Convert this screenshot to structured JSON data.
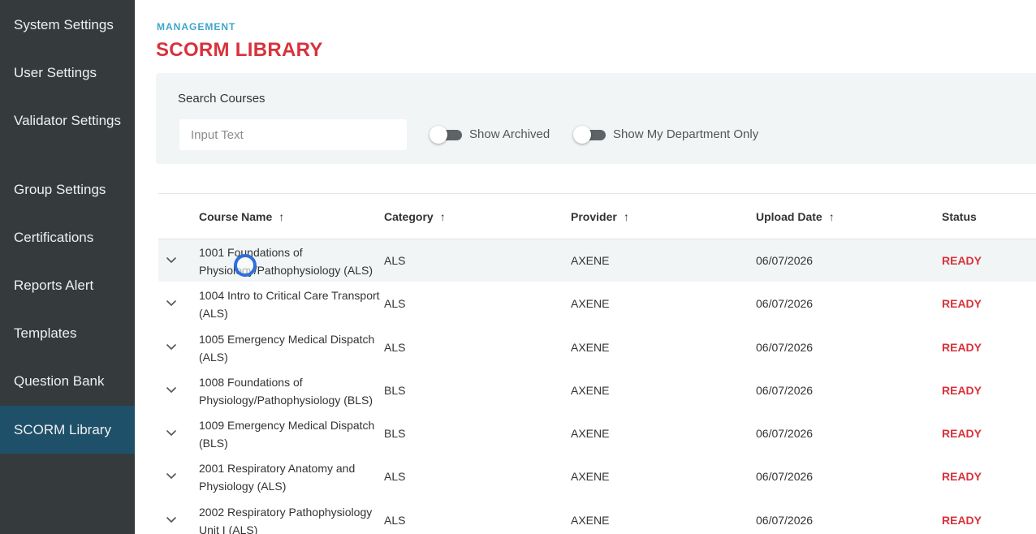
{
  "sidebar": {
    "items": [
      {
        "label": "System Settings",
        "active": false
      },
      {
        "label": "User Settings",
        "active": false
      },
      {
        "label": "Validator Settings",
        "active": false
      },
      {
        "label": "Group Settings",
        "active": false
      },
      {
        "label": "Certifications",
        "active": false
      },
      {
        "label": "Reports Alert",
        "active": false
      },
      {
        "label": "Templates",
        "active": false
      },
      {
        "label": "Question Bank",
        "active": false
      },
      {
        "label": "SCORM Library",
        "active": true
      }
    ],
    "active_color": "#1f5069",
    "background": "#353b3d"
  },
  "header": {
    "eyebrow": "MANAGEMENT",
    "title": "SCORM LIBRARY",
    "eyebrow_color": "#3ea6c8",
    "title_color": "#d8323c"
  },
  "filters": {
    "search_label": "Search Courses",
    "search_placeholder": "Input Text",
    "search_value": "",
    "show_archived_label": "Show Archived",
    "show_archived_on": false,
    "show_my_department_label": "Show My Department Only",
    "show_my_department_on": false
  },
  "table": {
    "columns": [
      "Course Name",
      "Category",
      "Provider",
      "Upload Date",
      "Status"
    ],
    "sortable": [
      true,
      true,
      true,
      true,
      false
    ],
    "rows": [
      {
        "name": "1001 Foundations of Physiology/Pathophysiology (ALS)",
        "category": "ALS",
        "provider": "AXENE",
        "date": "06/07/2026",
        "status": "READY"
      },
      {
        "name": "1004 Intro to Critical Care Transport (ALS)",
        "category": "ALS",
        "provider": "AXENE",
        "date": "06/07/2026",
        "status": "READY"
      },
      {
        "name": "1005 Emergency Medical Dispatch (ALS)",
        "category": "ALS",
        "provider": "AXENE",
        "date": "06/07/2026",
        "status": "READY"
      },
      {
        "name": "1008 Foundations of Physiology/Pathophysiology (BLS)",
        "category": "BLS",
        "provider": "AXENE",
        "date": "06/07/2026",
        "status": "READY"
      },
      {
        "name": "1009 Emergency Medical Dispatch (BLS)",
        "category": "BLS",
        "provider": "AXENE",
        "date": "06/07/2026",
        "status": "READY"
      },
      {
        "name": "2001 Respiratory Anatomy and Physiology (ALS)",
        "category": "ALS",
        "provider": "AXENE",
        "date": "06/07/2026",
        "status": "READY"
      },
      {
        "name": "2002 Respiratory Pathophysiology Unit I (ALS)",
        "category": "ALS",
        "provider": "AXENE",
        "date": "06/07/2026",
        "status": "READY"
      }
    ],
    "status_color": "#d8323c"
  },
  "icons": {
    "sort": "arrow-up-icon",
    "expand": "chevron-down-icon",
    "cursor": "click-cursor-icon"
  }
}
